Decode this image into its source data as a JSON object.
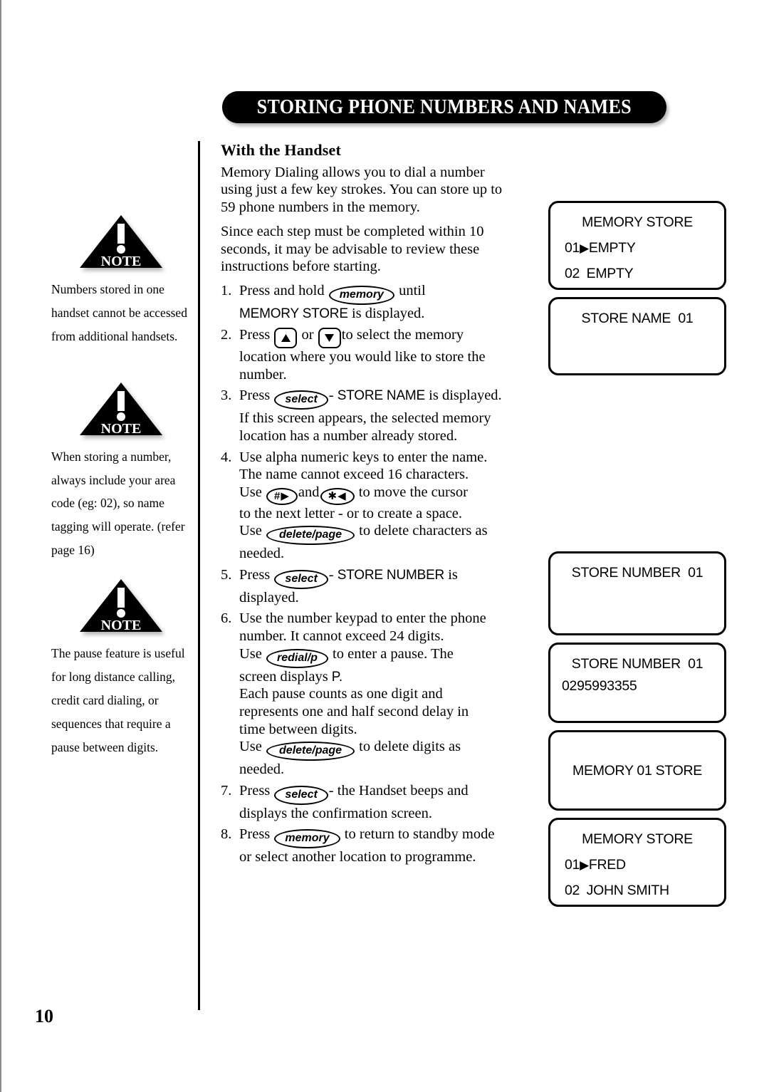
{
  "header": {
    "title": "STORING PHONE NUMBERS AND NAMES"
  },
  "page_number": "10",
  "notes": [
    {
      "icon": "warning-triangle-note-icon",
      "badge": "NOTE",
      "text": "Numbers stored in one handset cannot be accessed from additional handsets."
    },
    {
      "icon": "warning-triangle-note-icon",
      "badge": "NOTE",
      "text": "When storing a number, always include your area code (eg: 02), so name tagging will operate. (refer page 16)"
    },
    {
      "icon": "warning-triangle-note-icon",
      "badge": "NOTE",
      "text": "The pause feature is useful for long distance calling, credit card dialing, or sequences that require a pause between digits."
    }
  ],
  "main": {
    "subhead": "With the Handset",
    "intro_1": "Memory Dialing allows you to dial a number using just a few key strokes. You can store up to 59 phone numbers in the memory.",
    "intro_2": "Since each step must be completed within 10 seconds, it may be advisable to review these instructions before starting.",
    "steps": [
      {
        "num": "1.",
        "pre": "Press and hold",
        "key": "memory",
        "post": "until",
        "line2_lcd": "MEMORY STORE",
        "line2_tail": "is displayed."
      },
      {
        "num": "2.",
        "pre": "Press",
        "key_up": "up-arrow",
        "mid": "or",
        "key_down": "down-arrow",
        "post": "to select the memory",
        "line2": "location where you would like to store the",
        "line3": "number."
      },
      {
        "num": "3.",
        "pre": "Press",
        "key": "select",
        "post_dash": "-",
        "post_lcd": "STORE NAME",
        "post_tail": "is displayed.",
        "line2": "If this screen appears, the selected memory",
        "line3": "location has a number already stored."
      },
      {
        "num": "4.",
        "line1": "Use alpha numeric keys to enter the name.",
        "line2": "The name cannot exceed 16 characters.",
        "l3_pre": "Use",
        "l3_key1_a": "#",
        "l3_key1_b": "▶",
        "l3_mid": "and",
        "l3_key2_a": "✱",
        "l3_key2_b": "◀",
        "l3_post": "to move the cursor",
        "line4": "to the next letter - or to create a space.",
        "l5_pre": "Use",
        "l5_key": "delete/page",
        "l5_post": "to delete characters as",
        "line6": "needed."
      },
      {
        "num": "5.",
        "pre": "Press",
        "key": "select",
        "post_dash": "-",
        "post_lcd": "STORE NUMBER",
        "post_tail": "is",
        "line2": "displayed."
      },
      {
        "num": "6.",
        "line1": "Use the number keypad to enter the phone",
        "line2": "number. It cannot exceed 24 digits.",
        "l3_pre": "Use",
        "l3_key": "redial/p",
        "l3_post": "to enter a pause. The",
        "l4_pre": "screen displays",
        "l4_lcd": "P.",
        "line5": "Each pause counts as one digit and",
        "line6": "represents one and half second delay in",
        "line7": "time between digits.",
        "l8_pre": "Use",
        "l8_key": "delete/page",
        "l8_post": "to delete digits as",
        "line9": "needed."
      },
      {
        "num": "7.",
        "pre": "Press",
        "key": "select",
        "post": "- the Handset beeps and",
        "line2": "displays the confirmation screen."
      },
      {
        "num": "8.",
        "pre": "Press",
        "key": "memory",
        "post": "to return to standby mode",
        "line2": "or select another location to programme."
      }
    ]
  },
  "screens": [
    {
      "name": "memory-store-empty",
      "title": "MEMORY STORE",
      "rows": [
        {
          "index": "01",
          "caret": "▶",
          "value": "EMPTY"
        },
        {
          "index": "02",
          "caret": " ",
          "value": "EMPTY"
        }
      ]
    },
    {
      "name": "store-name-01",
      "title": "STORE NAME  01",
      "rows": []
    },
    {
      "name": "store-number-01",
      "title": "STORE NUMBER  01",
      "rows": []
    },
    {
      "name": "store-number-01-entered",
      "title": "STORE NUMBER  01",
      "plain": "0295993355"
    },
    {
      "name": "memory-01-store",
      "title": "MEMORY 01 STORE",
      "rows": []
    },
    {
      "name": "memory-store-filled",
      "title": "MEMORY STORE",
      "rows": [
        {
          "index": "01",
          "caret": "▶",
          "value": "FRED"
        },
        {
          "index": "02",
          "caret": " ",
          "value": "JOHN SMITH"
        }
      ]
    }
  ]
}
